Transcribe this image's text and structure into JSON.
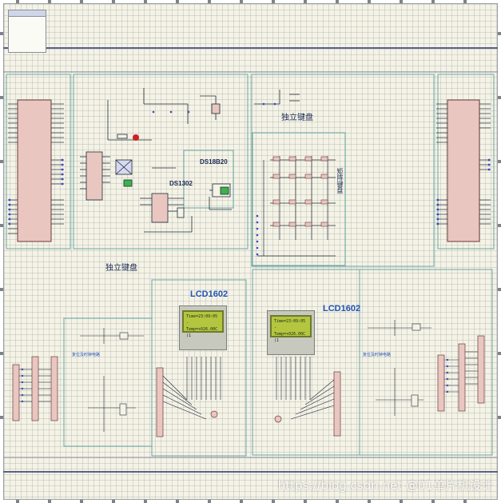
{
  "info_box": {
    "header": "",
    "lines": [
      "",
      ""
    ]
  },
  "labels": {
    "independent_keyboard_top": "独立键盘",
    "independent_keyboard_left": "独立键盘",
    "matrix_keyboard": "矩阵键盘",
    "ds18b20": "DS18B20",
    "ds1302": "DS1302",
    "lcd1602_left": "LCD1602",
    "lcd1602_right": "LCD1602",
    "reset_left": "复位及时钟电路",
    "reset_right": "复位及时钟电路"
  },
  "lcd_left": {
    "line1": "Time=23:09:05 -",
    "line2": "Temp=+026.00C (1"
  },
  "lcd_right": {
    "line1": "Time=23:09:05 -",
    "line2": "Temp=+026.00C (1"
  },
  "watermark": "https://blog.csdn.net @01单片机设计",
  "colors": {
    "sheet_bg": "#f4f3e6",
    "wire": "#1f2b3a",
    "box": "#6aa7a7",
    "chip": "#e9c6c0",
    "lcd_screen": "#b4c640",
    "title_blue": "#1f55b8"
  }
}
